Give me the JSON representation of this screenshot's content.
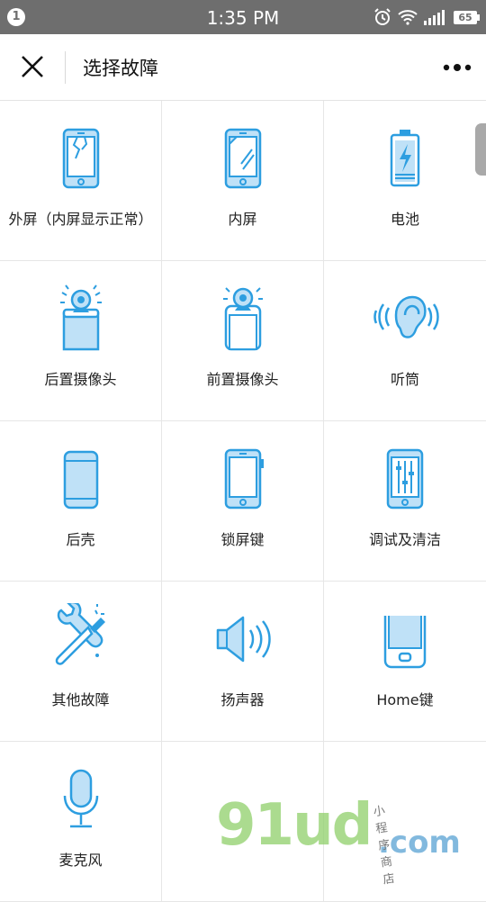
{
  "status_bar": {
    "notification_count": "1",
    "time": "1:35 PM",
    "battery": "65"
  },
  "header": {
    "title": "选择故障"
  },
  "faults": [
    {
      "label": "外屏（内屏显示正常）",
      "icon": "cracked-screen-icon"
    },
    {
      "label": "内屏",
      "icon": "inner-screen-icon"
    },
    {
      "label": "电池",
      "icon": "battery-icon"
    },
    {
      "label": "后置摄像头",
      "icon": "rear-camera-icon"
    },
    {
      "label": "前置摄像头",
      "icon": "front-camera-icon"
    },
    {
      "label": "听筒",
      "icon": "earpiece-icon"
    },
    {
      "label": "后壳",
      "icon": "back-cover-icon"
    },
    {
      "label": "锁屏键",
      "icon": "lock-button-icon"
    },
    {
      "label": "调试及清洁",
      "icon": "adjust-clean-icon"
    },
    {
      "label": "其他故障",
      "icon": "tools-icon"
    },
    {
      "label": "扬声器",
      "icon": "speaker-icon"
    },
    {
      "label": "Home键",
      "icon": "home-button-icon"
    },
    {
      "label": "麦克风",
      "icon": "microphone-icon"
    }
  ],
  "watermark": {
    "main": "91ud",
    "suffix": ".com",
    "tagline": "小程序商店"
  },
  "colors": {
    "accent": "#2d9ee0",
    "fill": "#bfe1f7",
    "status_bar": "#6e6e6e"
  }
}
